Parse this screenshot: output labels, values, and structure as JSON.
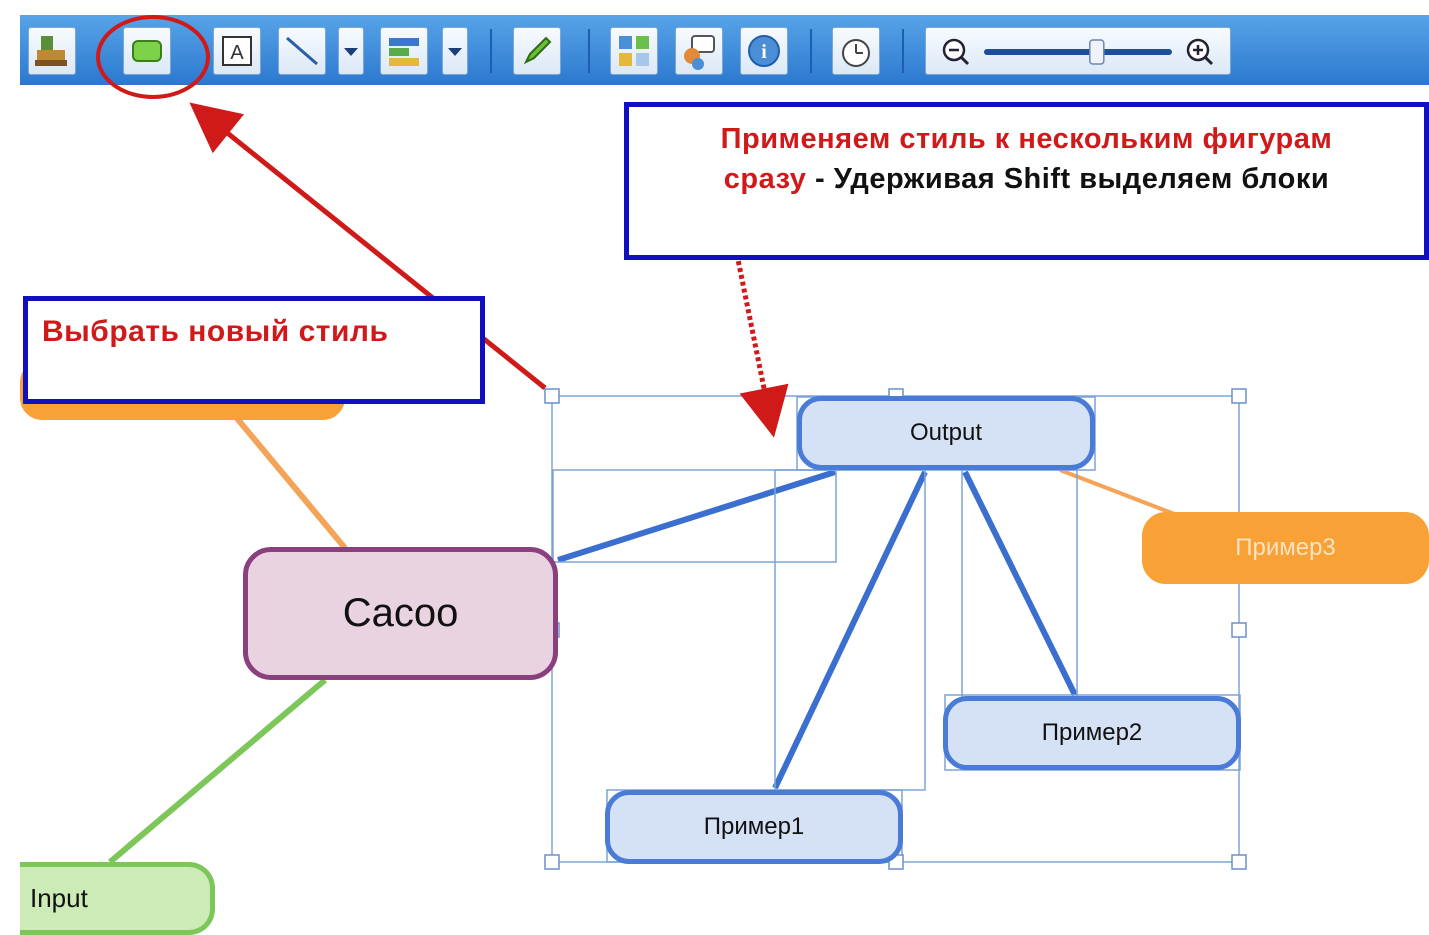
{
  "toolbar": {
    "buttons": [
      {
        "name": "stamp-icon"
      },
      {
        "name": "shape-style-icon"
      },
      {
        "name": "text-icon",
        "glyph": "A"
      },
      {
        "name": "connector-line-icon"
      },
      {
        "name": "connector-style-icon"
      },
      {
        "name": "pencil-icon"
      },
      {
        "name": "image-library-icon"
      },
      {
        "name": "comments-icon"
      },
      {
        "name": "info-icon",
        "glyph": "i"
      },
      {
        "name": "history-icon"
      }
    ],
    "zoom": {
      "level_fraction": 0.6
    }
  },
  "callouts": {
    "style": {
      "text": "Выбрать новый стиль"
    },
    "multi": {
      "red_text": "Применяем стиль к нескольким фигурам сразу",
      "black_text": " - Удерживая Shift выделяем блоки"
    }
  },
  "nodes": {
    "center": "Cacoo",
    "output": "Output",
    "example1": "Пример1",
    "example2": "Пример2",
    "example3": "Пример3",
    "input": "Input"
  },
  "colors": {
    "toolbar": "#2f7dd6",
    "accent_red": "#d01a1a",
    "callout_border": "#1010c0",
    "node_blue_fill": "#d5e1f5",
    "node_blue_border": "#4a7bd6",
    "node_orange": "#f7a136",
    "node_purple_fill": "#e9d3e1",
    "node_purple_border": "#8a3f7e",
    "node_green_fill": "#ccebb7",
    "node_green_border": "#7dc65a"
  }
}
